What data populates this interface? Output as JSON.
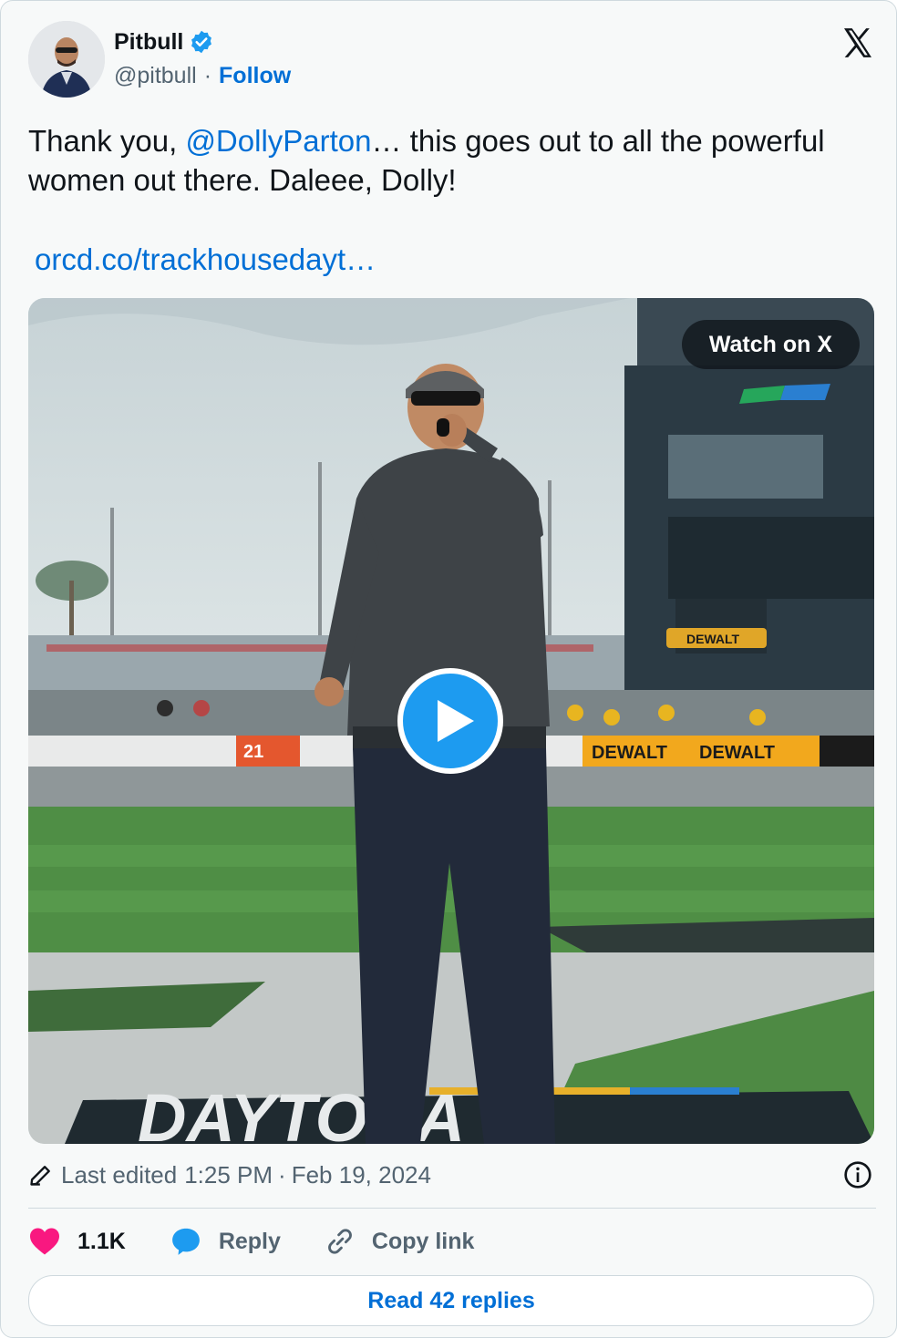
{
  "author": {
    "name": "Pitbull",
    "handle": "@pitbull",
    "separator": "·",
    "follow_label": "Follow",
    "verified_color": "#1d9bf0"
  },
  "platform_icon": "x-logo-icon",
  "tweet": {
    "text_before": "Thank you, ",
    "mention": "@DollyParton",
    "text_after": "… this goes out to all the powerful women out there. Daleee, Dolly!",
    "link": "orcd.co/trackhousedayt…"
  },
  "media": {
    "watch_label": "Watch on X",
    "play_icon": "play-icon",
    "play_color": "#1d9bf0",
    "signage": {
      "car_number": "21",
      "sponsor_1": "DEWALT",
      "sponsor_2": "DEWALT",
      "sponsor_3": "DEWALT",
      "track_name": "DAYTONA",
      "infield_word": "DAYTONA"
    }
  },
  "meta": {
    "edited_label": "Last edited",
    "time": "1:25 PM",
    "dot": "·",
    "date": "Feb 19, 2024"
  },
  "actions": {
    "like_count": "1.1K",
    "reply_label": "Reply",
    "copy_label": "Copy link"
  },
  "read_replies_label": "Read 42 replies",
  "colors": {
    "link_blue": "#006fd6",
    "like_pink": "#f91880",
    "muted": "#536471"
  }
}
